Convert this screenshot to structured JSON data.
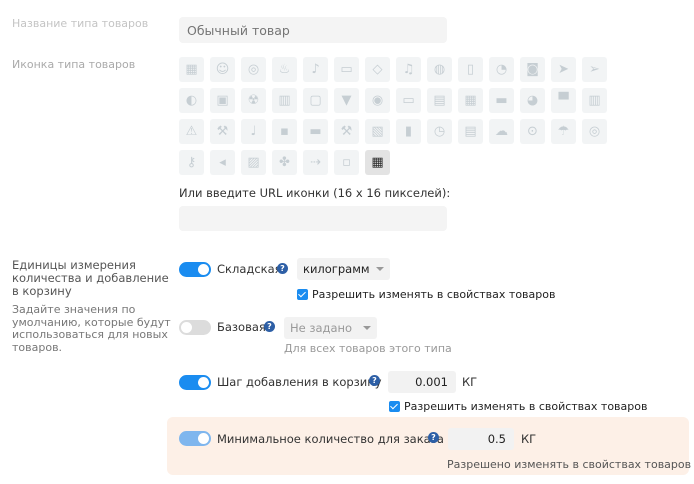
{
  "name_label": "Название типа товаров",
  "name_placeholder": "Обычный товар",
  "icon_label": "Иконка типа товаров",
  "icon_rows": [
    [
      "▦",
      "☺",
      "◎",
      "♨",
      "♪",
      "▭",
      "◇",
      "♫",
      "◍",
      "▯",
      "◔",
      "◙",
      "➤",
      "➢"
    ],
    [
      "◐",
      "▣",
      "☢",
      "▥",
      "▢",
      "▼",
      "◉",
      "▭",
      "▤",
      "▦",
      "▬",
      "◕",
      "▀",
      "▥"
    ],
    [
      "⚠",
      "⚒",
      "♩",
      "▪",
      "▬",
      "⚒",
      "▧",
      "▮",
      "◷",
      "▤",
      "☁",
      "⊙",
      "☂",
      "◎"
    ],
    [
      "⚷",
      "◂",
      "▨",
      "✤",
      "⇢",
      "▫",
      "▦"
    ]
  ],
  "url_label": "Или введите URL иконки (16 x 16 пикселей):",
  "units_label": "Единицы измерения количества и добавление в корзину",
  "units_note": "Задайте значения по умолчанию, которые будут использоваться для новых товаров.",
  "stock": {
    "label": "Складская",
    "unit_value": "килограмм",
    "allow_label": "Разрешить изменять в свойствах товаров"
  },
  "base": {
    "label": "Базовая",
    "unit_value": "Не задано",
    "hint": "Для всех товаров этого типа"
  },
  "step": {
    "label": "Шаг добавления в корзину",
    "value": "0.001",
    "unit": "КГ",
    "allow_label": "Разрешить изменять в свойствах товаров"
  },
  "min": {
    "label": "Минимальное количество для заказа",
    "value": "0.5",
    "unit": "КГ",
    "allowed_text": "Разрешено изменять в свойствах товаров"
  },
  "help_glyph": "?"
}
